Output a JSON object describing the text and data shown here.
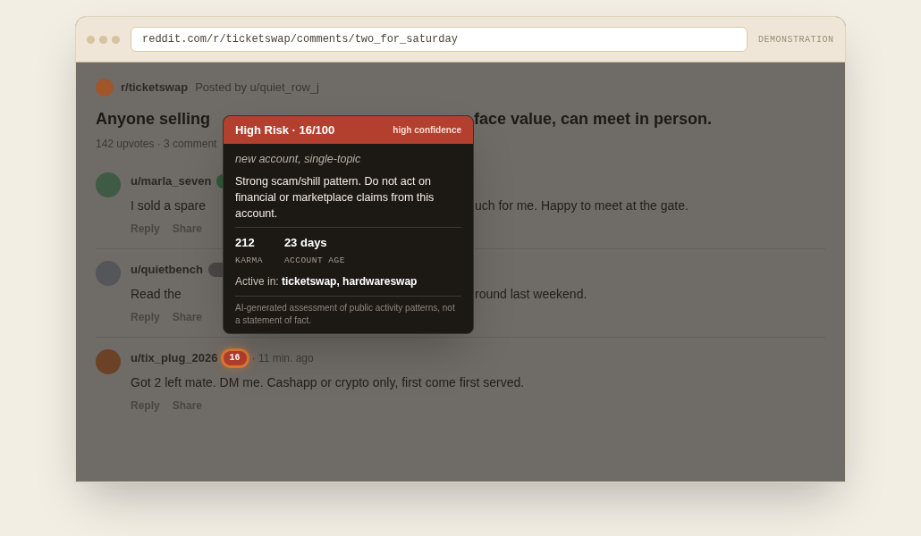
{
  "browser": {
    "url": "reddit.com/r/ticketswap/comments/two_for_saturday",
    "label": "DEMONSTRATION"
  },
  "post": {
    "subreddit": "r/ticketswap",
    "posted_by": "Posted by u/quiet_row_j",
    "title_left": "Anyone selling",
    "title_right": "face value, can meet in person.",
    "meta": "142 upvotes · 3 comment"
  },
  "comments": [
    {
      "user": "u/marla_seven",
      "color": "#3f5a45",
      "badge": {
        "color": "#2f5a38"
      },
      "text_left": "I sold a spare",
      "text_right": "uch for me. Happy to meet at the gate.",
      "actions": [
        "Reply",
        "Share"
      ]
    },
    {
      "user": "u/quietbench",
      "color": "#55565a",
      "badge": {
        "color": "#4a4744"
      },
      "text_left": "Read the",
      "text_right": "round last weekend.",
      "actions": [
        "Reply",
        "Share"
      ]
    },
    {
      "user": "u/tix_plug_2026",
      "color": "#6b4226",
      "badge": {
        "text": "16",
        "color": "#b33f2e",
        "highlighted": true
      },
      "time": "· 11 min. ago",
      "text_left": "Got 2 left mate. DM me. Cashapp or crypto only, first come first served.",
      "actions": [
        "Reply",
        "Share"
      ]
    }
  ],
  "popover": {
    "title": "High Risk · 16/100",
    "confidence": "high confidence",
    "tags": "new account, single-topic",
    "summary": "Strong scam/shill pattern. Do not act on financial or marketplace claims from this account.",
    "stats": [
      {
        "value": "212",
        "label": "KARMA"
      },
      {
        "value": "23 days",
        "label": "ACCOUNT AGE"
      }
    ],
    "active": "Active in: **ticketswap, hardwareswap**",
    "disclaimer": "AI-generated assessment of public activity patterns, not a statement of fact."
  }
}
